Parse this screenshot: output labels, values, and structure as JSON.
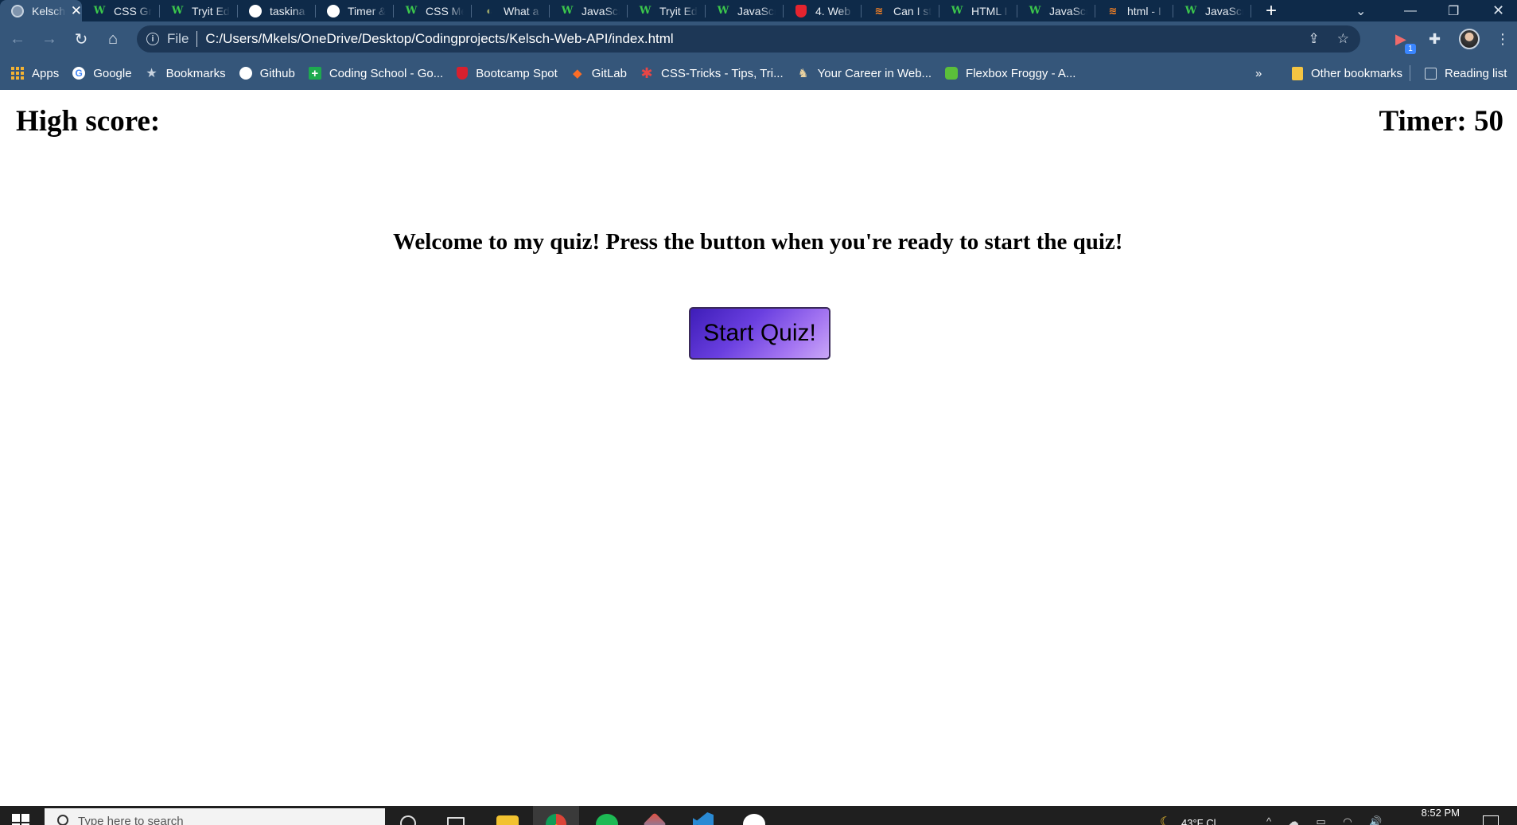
{
  "tabs": [
    {
      "title": "Kelsch",
      "favicon": "globe-icon",
      "active": true
    },
    {
      "title": "CSS Gr",
      "favicon": "w3schools-icon"
    },
    {
      "title": "Tryit Ed",
      "favicon": "w3schools-icon"
    },
    {
      "title": "taskina",
      "favicon": "github-icon"
    },
    {
      "title": "Timer &",
      "favicon": "github-icon"
    },
    {
      "title": "CSS Me",
      "favicon": "w3schools-icon"
    },
    {
      "title": "What a",
      "favicon": "snail-icon"
    },
    {
      "title": "JavaScr",
      "favicon": "w3schools-icon"
    },
    {
      "title": "Tryit Ed",
      "favicon": "w3schools-icon"
    },
    {
      "title": "JavaScr",
      "favicon": "w3schools-icon"
    },
    {
      "title": "4. Web",
      "favicon": "bootcamp-icon"
    },
    {
      "title": "Can I st",
      "favicon": "stackoverflow-icon"
    },
    {
      "title": "HTML I",
      "favicon": "w3schools-icon"
    },
    {
      "title": "JavaScr",
      "favicon": "w3schools-icon"
    },
    {
      "title": "html - I",
      "favicon": "stackoverflow-icon"
    },
    {
      "title": "JavaScr",
      "favicon": "w3schools-icon"
    }
  ],
  "toolbar": {
    "file_label": "File",
    "url": "C:/Users/Mkels/OneDrive/Desktop/Codingprojects/Kelsch-Web-API/index.html",
    "extension_badge": "1"
  },
  "bookmarks": [
    {
      "label": "Apps",
      "icon": "apps-grid-icon"
    },
    {
      "label": "Google",
      "icon": "google-icon"
    },
    {
      "label": "Bookmarks",
      "icon": "star-icon"
    },
    {
      "label": "Github",
      "icon": "github-icon"
    },
    {
      "label": "Coding School - Go...",
      "icon": "plus-icon"
    },
    {
      "label": "Bootcamp Spot",
      "icon": "bootcamp-icon"
    },
    {
      "label": "GitLab",
      "icon": "gitlab-icon"
    },
    {
      "label": "CSS-Tricks - Tips, Tri...",
      "icon": "asterisk-icon"
    },
    {
      "label": "Your Career in Web...",
      "icon": "owl-icon"
    },
    {
      "label": "Flexbox Froggy - A...",
      "icon": "frog-icon"
    }
  ],
  "bookmarks_more": "»",
  "other_bookmarks": "Other bookmarks",
  "reading_list": "Reading list",
  "page": {
    "high_score_label": "High score:",
    "timer_label": "Timer: 50",
    "welcome_text": "Welcome to my quiz! Press the button when you're ready to start the quiz!",
    "start_button": "Start Quiz!"
  },
  "taskbar": {
    "search_placeholder": "Type here to search",
    "weather": "43°F Cl",
    "time": "8:52 PM"
  }
}
